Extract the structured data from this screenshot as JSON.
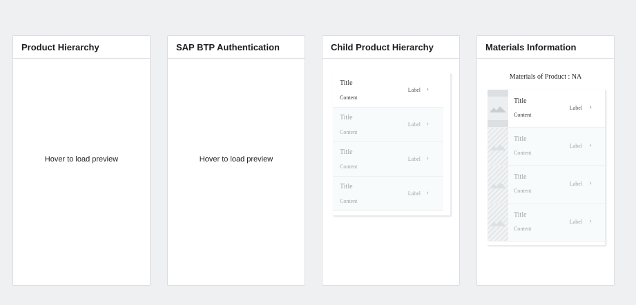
{
  "cards": [
    {
      "title": "Product Hierarchy",
      "hover_text": "Hover to load preview"
    },
    {
      "title": "SAP BTP Authentication",
      "hover_text": "Hover to load preview"
    },
    {
      "title": "Child Product Hierarchy",
      "list": [
        {
          "title": "Title",
          "content": "Content",
          "label": "Label",
          "chevron": "›"
        },
        {
          "title": "Title",
          "content": "Content",
          "label": "Label",
          "chevron": "›"
        },
        {
          "title": "Title",
          "content": "Content",
          "label": "Label",
          "chevron": "›"
        },
        {
          "title": "Title",
          "content": "Content",
          "label": "Label",
          "chevron": "›"
        }
      ]
    },
    {
      "title": "Materials Information",
      "heading": "Materials of Product : NA",
      "list": [
        {
          "title": "Title",
          "content": "Content",
          "label": "Label",
          "chevron": "›",
          "icon": "image-placeholder-icon"
        },
        {
          "title": "Title",
          "content": "Content",
          "label": "Label",
          "chevron": "›",
          "icon": "image-placeholder-icon"
        },
        {
          "title": "Title",
          "content": "Content",
          "label": "Label",
          "chevron": "›",
          "icon": "image-placeholder-icon"
        },
        {
          "title": "Title",
          "content": "Content",
          "label": "Label",
          "chevron": "›",
          "icon": "image-placeholder-icon"
        }
      ]
    }
  ],
  "colors": {
    "background": "#eff0f2",
    "card": "#ffffff",
    "border": "#dcdde0",
    "faded_row": "#f7fbfc"
  }
}
